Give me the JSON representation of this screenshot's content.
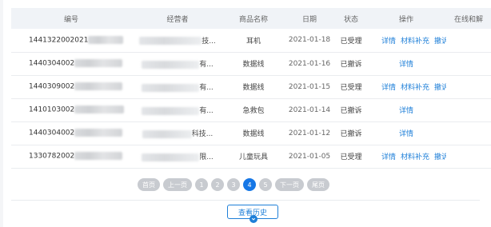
{
  "table": {
    "headers": [
      "编号",
      "经营者",
      "商品名称",
      "日期",
      "状态",
      "操作",
      "在线和解"
    ],
    "rows": [
      {
        "code": "1441322002021",
        "operator_suffix": "技...",
        "product": "耳机",
        "date": "2021-01-18",
        "status": "已受理",
        "status_type": "ok",
        "ops": [
          "详情",
          "材料补充",
          "撤诉"
        ]
      },
      {
        "code": "1440304002",
        "operator_suffix": "有...",
        "product": "数据线",
        "date": "2021-01-16",
        "status": "已撤诉",
        "status_type": "cancel",
        "ops": [
          "详情"
        ]
      },
      {
        "code": "1440309002",
        "operator_suffix": "有...",
        "product": "数据线",
        "date": "2021-01-15",
        "status": "已受理",
        "status_type": "ok",
        "ops": [
          "详情",
          "材料补充",
          "撤诉"
        ]
      },
      {
        "code": "1410103002",
        "operator_suffix": "有...",
        "product": "急救包",
        "date": "2021-01-14",
        "status": "已撤诉",
        "status_type": "cancel",
        "ops": [
          "详情"
        ]
      },
      {
        "code": "1440304002",
        "operator_suffix": "科技...",
        "product": "数据线",
        "date": "2021-01-12",
        "status": "已撤诉",
        "status_type": "cancel",
        "ops": [
          "详情"
        ]
      },
      {
        "code": "1330782002",
        "operator_suffix": "限...",
        "product": "儿童玩具",
        "date": "2021-01-05",
        "status": "已受理",
        "status_type": "ok",
        "ops": [
          "详情",
          "材料补充",
          "撤诉"
        ]
      }
    ]
  },
  "pager": {
    "first": "首页",
    "prev": "上一页",
    "pages": [
      "1",
      "2",
      "3",
      "4",
      "5"
    ],
    "current": "4",
    "next": "下一页",
    "last": "尾页"
  },
  "history_button": "查看历史",
  "colors": {
    "accent": "#1e7fd8",
    "active_page": "#1677e6",
    "muted": "#8a8a8a"
  }
}
